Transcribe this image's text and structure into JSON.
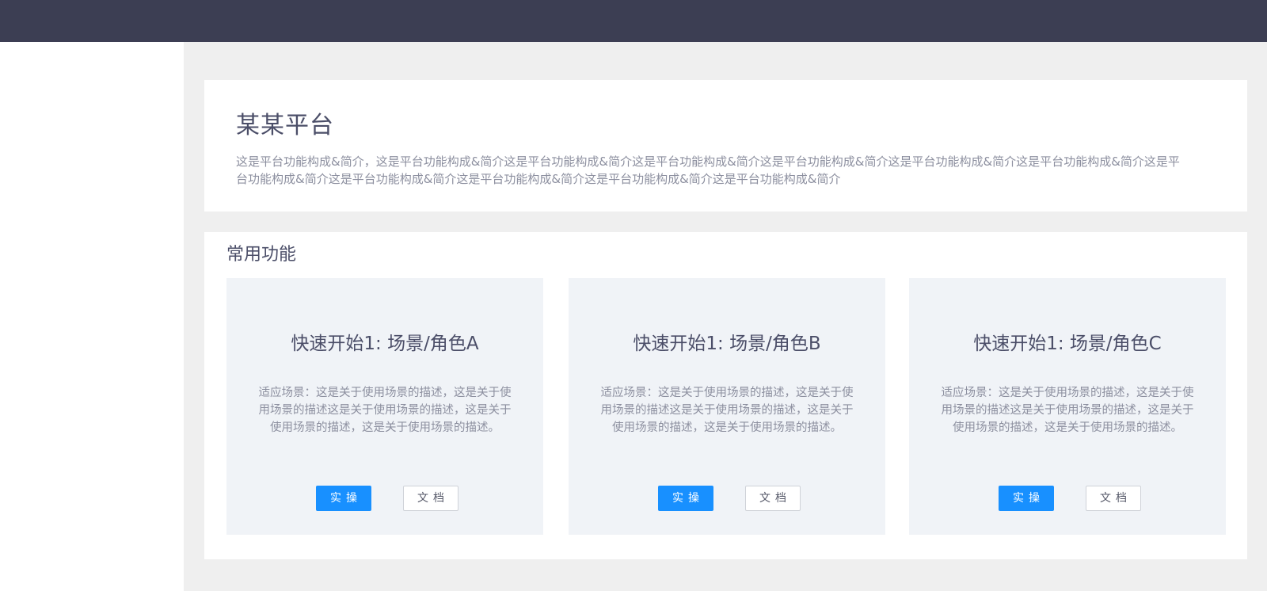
{
  "intro": {
    "title": "某某平台",
    "description": "这是平台功能构成&简介，这是平台功能构成&简介这是平台功能构成&简介这是平台功能构成&简介这是平台功能构成&简介这是平台功能构成&简介这是平台功能构成&简介这是平台功能构成&简介这是平台功能构成&简介这是平台功能构成&简介这是平台功能构成&简介这是平台功能构成&简介"
  },
  "features": {
    "title": "常用功能",
    "cards": [
      {
        "title": "快速开始1: 场景/角色A",
        "description": "适应场景：这是关于使用场景的描述，这是关于使用场景的描述这是关于使用场景的描述，这是关于使用场景的描述，这是关于使用场景的描述。",
        "primary_label": "实操",
        "secondary_label": "文档"
      },
      {
        "title": "快速开始1: 场景/角色B",
        "description": "适应场景：这是关于使用场景的描述，这是关于使用场景的描述这是关于使用场景的描述，这是关于使用场景的描述，这是关于使用场景的描述。",
        "primary_label": "实操",
        "secondary_label": "文档"
      },
      {
        "title": "快速开始1: 场景/角色C",
        "description": "适应场景：这是关于使用场景的描述，这是关于使用场景的描述这是关于使用场景的描述，这是关于使用场景的描述，这是关于使用场景的描述。",
        "primary_label": "实操",
        "secondary_label": "文档"
      }
    ]
  },
  "colors": {
    "topbar": "#3c3e53",
    "primary": "#1890ff",
    "card_background": "#f0f3f7",
    "page_background": "#efefef"
  }
}
